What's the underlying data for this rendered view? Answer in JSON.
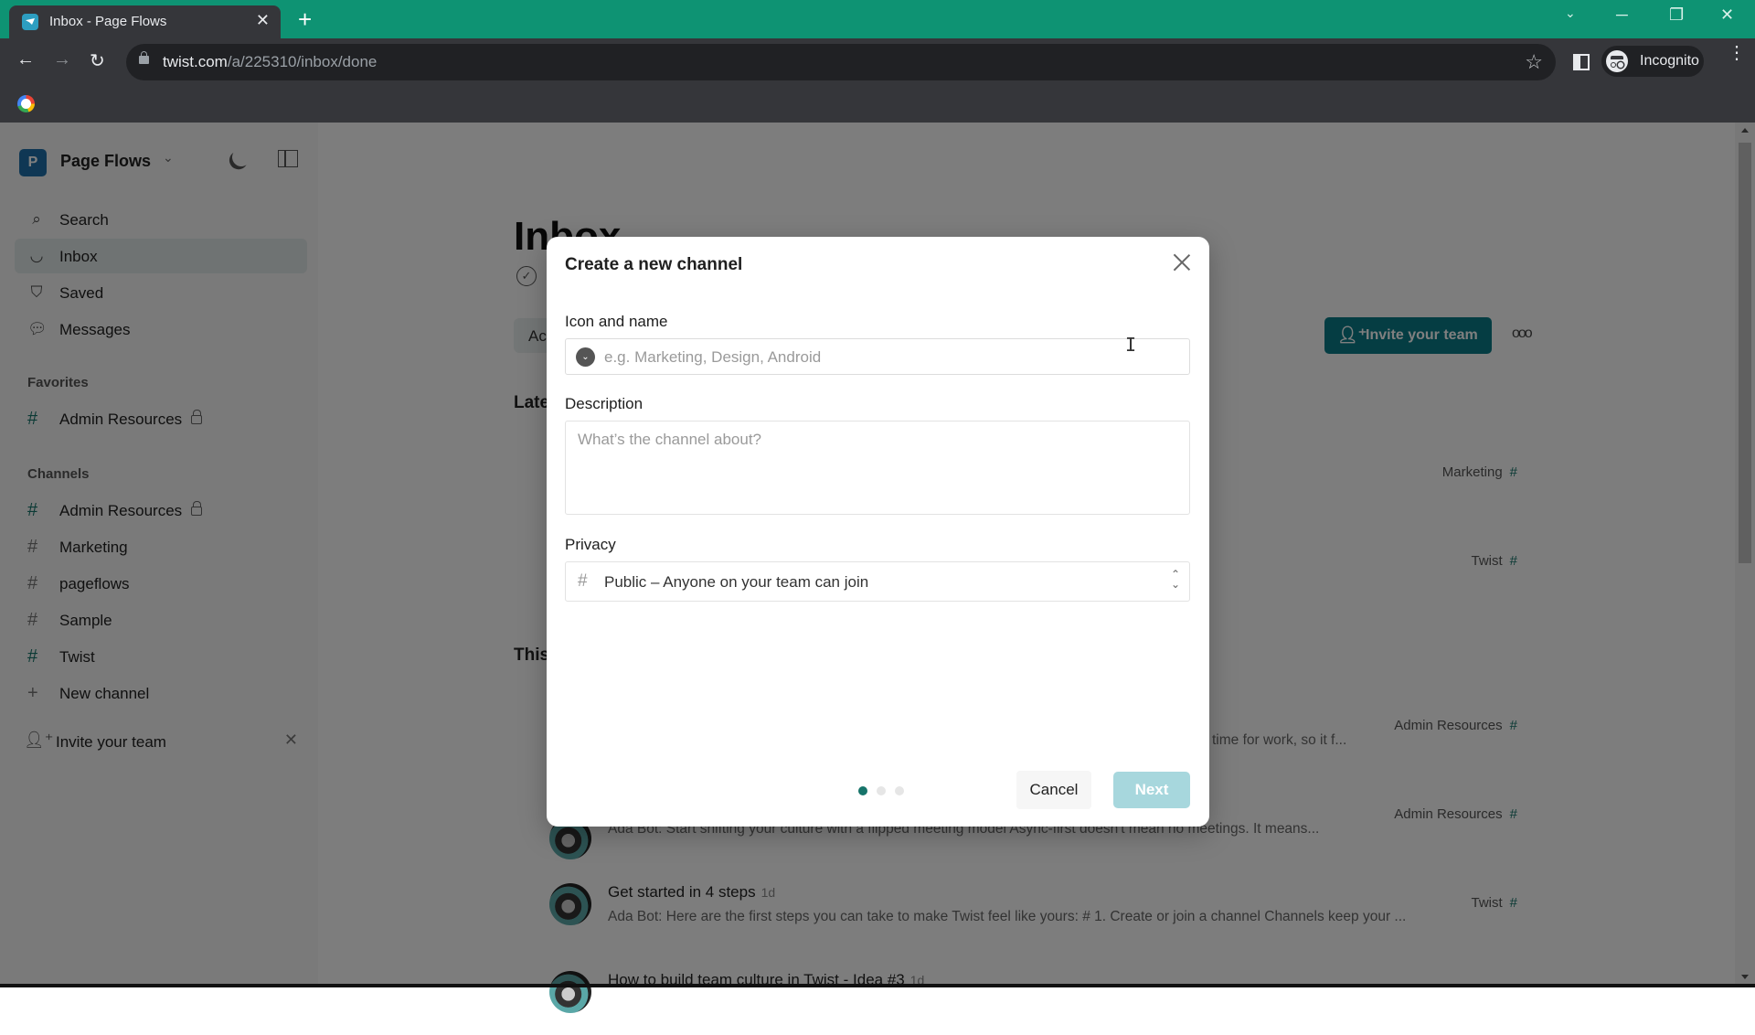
{
  "browser": {
    "tab_title": "Inbox - Page Flows",
    "new_tab_label": "+",
    "url_domain": "twist.com",
    "url_path": "/a/225310/inbox/done",
    "profile_label": "Incognito",
    "window_controls": [
      "chevron-down",
      "minimize",
      "restore",
      "close"
    ]
  },
  "sidebar": {
    "workspace_initial": "P",
    "workspace_name": "Page Flows",
    "nav": [
      {
        "label": "Search",
        "icon": "search-icon"
      },
      {
        "label": "Inbox",
        "icon": "inbox-icon",
        "active": true
      },
      {
        "label": "Saved",
        "icon": "bookmark-icon"
      },
      {
        "label": "Messages",
        "icon": "chat-icon"
      }
    ],
    "favorites_heading": "Favorites",
    "favorites": [
      {
        "label": "Admin Resources",
        "locked": true
      }
    ],
    "channels_heading": "Channels",
    "channels": [
      {
        "label": "Admin Resources",
        "locked": true
      },
      {
        "label": "Marketing",
        "locked": false
      },
      {
        "label": "pageflows",
        "locked": false
      },
      {
        "label": "Sample",
        "locked": false
      },
      {
        "label": "Twist",
        "locked": false
      }
    ],
    "new_channel_label": "New channel",
    "invite_label": "Invite your team"
  },
  "main": {
    "title": "Inbox",
    "filter_label": "Ac",
    "section_latest": "Late",
    "section_this": "This",
    "invite_button": "Invite your team",
    "more_label": "ooo",
    "right_tags": [
      {
        "label": "Marketing"
      },
      {
        "label": "Twist"
      },
      {
        "label": "Admin Resources"
      },
      {
        "label": "Admin Resources"
      },
      {
        "label": "Twist"
      }
    ],
    "rows": [
      {
        "title": "",
        "time": "",
        "preview": "time for work, so it f..."
      },
      {
        "title": "",
        "time": "",
        "preview": "Ada Bot: Start shifting your culture with a flipped meeting model Async-first doesn't mean no meetings. It means..."
      },
      {
        "title": "Get started in 4 steps",
        "time": "1d",
        "preview": "Ada Bot: Here are the first steps you can take to make Twist feel like yours: # 1. Create or join a channel Channels keep your ..."
      },
      {
        "title": "How to build team culture in Twist - Idea #3",
        "time": "1d",
        "preview": ""
      }
    ]
  },
  "modal": {
    "title": "Create a new channel",
    "name_label": "Icon and name",
    "name_placeholder": "e.g. Marketing, Design, Android",
    "name_value": "",
    "description_label": "Description",
    "description_placeholder": "What’s the channel about?",
    "description_value": "",
    "privacy_label": "Privacy",
    "privacy_value": "Public – Anyone on your team can join",
    "step_current": 1,
    "step_total": 3,
    "cancel_label": "Cancel",
    "next_label": "Next",
    "accent_color": "#17746a",
    "next_disabled_color": "#a7d7dd"
  }
}
